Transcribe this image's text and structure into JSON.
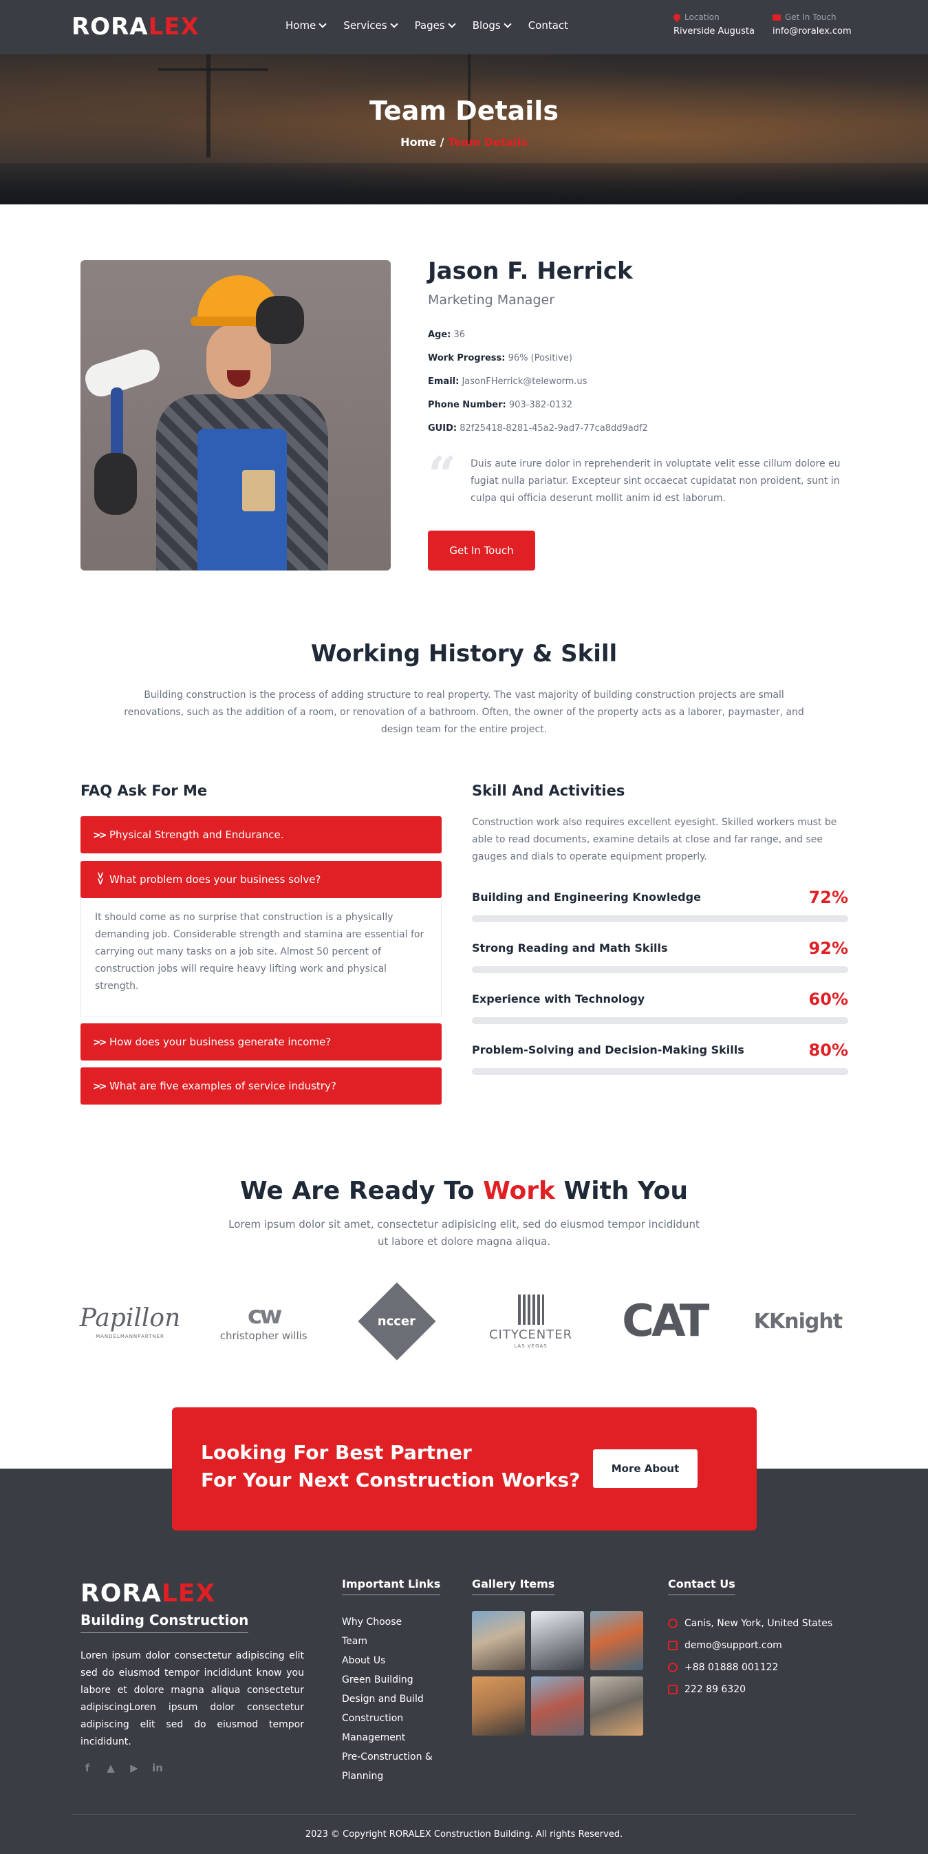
{
  "header": {
    "logo_white": "RORA",
    "logo_red": "LEX",
    "nav": [
      {
        "label": "Home"
      },
      {
        "label": "Services"
      },
      {
        "label": "Pages"
      },
      {
        "label": "Blogs"
      },
      {
        "label": "Contact"
      }
    ],
    "location_label": "Location",
    "location_value": "Riverside Augusta",
    "touch_label": "Get In Touch",
    "touch_value": "info@roralex.com"
  },
  "hero": {
    "title": "Team Details",
    "crumb_home": "Home",
    "crumb_sep": " / ",
    "crumb_current": "Team Details"
  },
  "profile": {
    "name": "Jason F. Herrick",
    "role": "Marketing Manager",
    "details": [
      {
        "label": "Age:",
        "value": "36"
      },
      {
        "label": "Work Progress:",
        "value": "96% (Positive)"
      },
      {
        "label": "Email:",
        "value": "JasonFHerrick@teleworm.us"
      },
      {
        "label": "Phone Number:",
        "value": "903-382-0132"
      },
      {
        "label": "GUID:",
        "value": "82f25418-8281-45a2-9ad7-77ca8dd9adf2"
      }
    ],
    "quote": "Duis aute irure dolor in reprehenderit in voluptate velit esse cillum dolore eu fugiat nulla pariatur. Excepteur sint occaecat cupidatat non proident, sunt in culpa qui officia deserunt mollit anim id est laborum.",
    "button": "Get In Touch"
  },
  "history": {
    "title": "Working History & Skill",
    "text": "Building construction is the process of adding structure to real property. The vast majority of building construction projects are small renovations, such as the addition of a room, or renovation of a bathroom. Often, the owner of the property acts as a laborer, paymaster, and design team for the entire project."
  },
  "faq": {
    "title": "FAQ Ask For Me",
    "items": [
      {
        "q": "Physical Strength and Endurance."
      },
      {
        "q": "What problem does your business solve?"
      },
      {
        "q": "How does your business generate income?"
      },
      {
        "q": "What are five examples of service industry?"
      }
    ],
    "open_answer": "It should come as no surprise that construction is a physically demanding job. Considerable strength and stamina are essential for carrying out many tasks on a job site. Almost 50 percent of construction jobs will require heavy lifting work and physical strength."
  },
  "skills": {
    "title": "Skill And Activities",
    "text": "Construction work also requires excellent eyesight. Skilled workers must be able to read documents, examine details at close and far range, and see gauges and dials to operate equipment properly.",
    "items": [
      {
        "name": "Building and Engineering Knowledge",
        "percent": "72%",
        "value": 72
      },
      {
        "name": "Strong Reading and Math Skills",
        "percent": "92%",
        "value": 92
      },
      {
        "name": "Experience with Technology",
        "percent": "60%",
        "value": 60
      },
      {
        "name": "Problem-Solving and Decision-Making Skills",
        "percent": "80%",
        "value": 80
      }
    ]
  },
  "ready": {
    "title_a": "We Are Ready To ",
    "title_red": "Work",
    "title_b": " With You",
    "text": "Lorem ipsum dolor sit amet, consectetur adipisicing elit, sed do eiusmod tempor incididunt ut labore et dolore magna aliqua."
  },
  "brands": {
    "papillon": "Papillon",
    "papillon_small": "MANDELMANNPARTNER",
    "cw": "cw",
    "cw_text": "christopher willis",
    "nccer": "nccer",
    "city": "CITYCENTER",
    "city_small": "LAS VEGAS",
    "cat": "CAT",
    "knight": "Knight"
  },
  "cta": {
    "line1": "Looking For Best Partner",
    "line2": "For Your Next Construction Works?",
    "button": "More About"
  },
  "footer": {
    "logo_white": "RORA",
    "logo_red": "LEX",
    "brand": "Building Construction",
    "desc": "Loren ipsum dolor consectetur adipiscing elit sed do eiusmod tempor incididunt know you labore et dolore magna aliqua consectetur adipiscingLoren ipsum dolor consectetur adipiscing elit sed do eiusmod tempor incididunt.",
    "links_title": "Important Links",
    "links": [
      "Why Choose",
      "Team",
      "About Us",
      "Green Building",
      "Design and Build",
      "Construction",
      "Management",
      "Pre-Construction &",
      "Planning"
    ],
    "gallery_title": "Gallery Items",
    "contact_title": "Contact Us",
    "contact": [
      {
        "icon": "globe-icon",
        "text": "Canis, New York, United States"
      },
      {
        "icon": "mail-icon",
        "text": "demo@support.com"
      },
      {
        "icon": "phone-icon",
        "text": "+88 01888 001122"
      },
      {
        "icon": "fax-icon",
        "text": "222 89 6320"
      }
    ],
    "copyright": "2023 © Copyright RORALEX Construction Building. All rights Reserved."
  },
  "colors": {
    "accent": "#e02024",
    "dark": "#3a3d44",
    "text": "#1f2937",
    "muted": "#6b7280"
  }
}
